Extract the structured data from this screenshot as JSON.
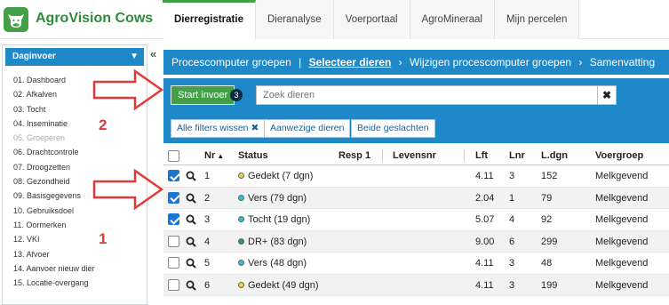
{
  "app": {
    "title": "AgroVision Cows",
    "logo_icon": "cow-icon",
    "brand_color": "#43a047",
    "accent_color": "#1e88c8"
  },
  "tabs": [
    {
      "label": "Dierregistratie",
      "active": true
    },
    {
      "label": "Dieranalyse"
    },
    {
      "label": "Voerportaal"
    },
    {
      "label": "AgroMineraal"
    },
    {
      "label": "Mijn percelen"
    }
  ],
  "sidebar": {
    "title": "Daginvoer",
    "collapse_label": "«",
    "items": [
      {
        "label": "01. Dashboard"
      },
      {
        "label": "02. Afkalven"
      },
      {
        "label": "03. Tocht"
      },
      {
        "label": "04. Inseminatie"
      },
      {
        "label": "05. Groeperen",
        "disabled": true
      },
      {
        "label": "06. Drachtcontrole"
      },
      {
        "label": "07. Droogzetten"
      },
      {
        "label": "08. Gezondheid"
      },
      {
        "label": "09. Basisgegevens"
      },
      {
        "label": "10. Gebruiksdoel"
      },
      {
        "label": "11. Oormerken"
      },
      {
        "label": "12. VKI"
      },
      {
        "label": "13. Afvoer"
      },
      {
        "label": "14. Aanvoer nieuw dier"
      },
      {
        "label": "15. Locatie-overgang"
      }
    ]
  },
  "breadcrumb": {
    "step1": "Procescomputer groepen",
    "sep1": "|",
    "step2": "Selecteer dieren",
    "sep2": "›",
    "step3": "Wijzigen procescomputer groepen",
    "sep3": "›",
    "step4": "Samenvatting"
  },
  "actions": {
    "start_label": "Start invoer",
    "selected_count": "3",
    "search_placeholder": "Zoek dieren",
    "clear_label": "✖",
    "filter_clear": "Alle filters wissen ✖",
    "filter_present": "Aanwezige dieren",
    "filter_both": "Beide geslachten"
  },
  "table": {
    "headers": {
      "nr": "Nr",
      "nr_sort": "▲",
      "status": "Status",
      "resp": "Resp 1",
      "levensnr": "Levensnr",
      "lft": "Lft",
      "lnr": "Lnr",
      "ldgn": "L.dgn",
      "voergroep": "Voergroep"
    },
    "rows": [
      {
        "checked": true,
        "nr": "1",
        "status": "Gedekt (7 dgn)",
        "dot": "#f4d03f",
        "lft": "4.11",
        "lnr": "3",
        "ldgn": "152",
        "voergroep": "Melkgevend"
      },
      {
        "checked": true,
        "nr": "2",
        "status": "Vers (79 dgn)",
        "dot": "#26c6da",
        "lft": "2.04",
        "lnr": "1",
        "ldgn": "79",
        "voergroep": "Melkgevend"
      },
      {
        "checked": true,
        "nr": "3",
        "status": "Tocht (19 dgn)",
        "dot": "#26c6da",
        "lft": "5.07",
        "lnr": "4",
        "ldgn": "92",
        "voergroep": "Melkgevend"
      },
      {
        "checked": false,
        "nr": "4",
        "status": "DR+ (83 dgn)",
        "dot": "#2e9e3e",
        "lft": "9.00",
        "lnr": "6",
        "ldgn": "299",
        "voergroep": "Melkgevend"
      },
      {
        "checked": false,
        "nr": "5",
        "status": "Vers (48 dgn)",
        "dot": "#26c6da",
        "lft": "4.11",
        "lnr": "3",
        "ldgn": "48",
        "voergroep": "Melkgevend"
      },
      {
        "checked": false,
        "nr": "6",
        "status": "Gedekt (49 dgn)",
        "dot": "#f4d03f",
        "lft": "4.11",
        "lnr": "3",
        "ldgn": "199",
        "voergroep": "Melkgevend"
      }
    ]
  },
  "annotations": {
    "label_1": "1",
    "label_2": "2",
    "color": "#e53935"
  }
}
